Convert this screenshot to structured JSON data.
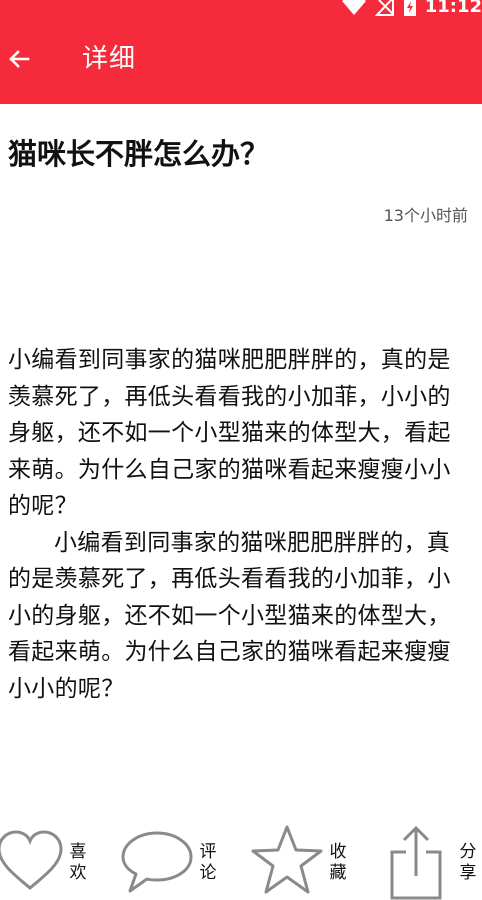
{
  "status_bar": {
    "time": "11:12",
    "icons": [
      "wifi-icon",
      "signal-icon",
      "battery-charging-icon"
    ]
  },
  "app_bar": {
    "back_icon": "arrow-left-icon",
    "title": "详细",
    "background_color": "#f52a3a"
  },
  "article": {
    "title": "猫咪长不胖怎么办？",
    "time_ago": "13个小时前",
    "paragraphs": [
      "小编看到同事家的猫咪肥肥胖胖的，真的是羡慕死了，再低头看看我的小加菲，小小的身躯，还不如一个小型猫来的体型大，看起来萌。为什么自己家的猫咪看起来瘦瘦小小的呢？",
      "小编看到同事家的猫咪肥肥胖胖的，真的是羡慕死了，再低头看看我的小加菲，小小的身躯，还不如一个小型猫来的体型大，看起来萌。为什么自己家的猫咪看起来瘦瘦小小的呢？"
    ]
  },
  "bottom_bar": {
    "like": {
      "label": "喜欢",
      "icon": "heart-icon"
    },
    "comment": {
      "label": "评论",
      "icon": "speech-bubble-icon"
    },
    "favorite": {
      "label": "收藏",
      "icon": "star-icon"
    },
    "share": {
      "label": "分享",
      "icon": "share-icon"
    }
  }
}
